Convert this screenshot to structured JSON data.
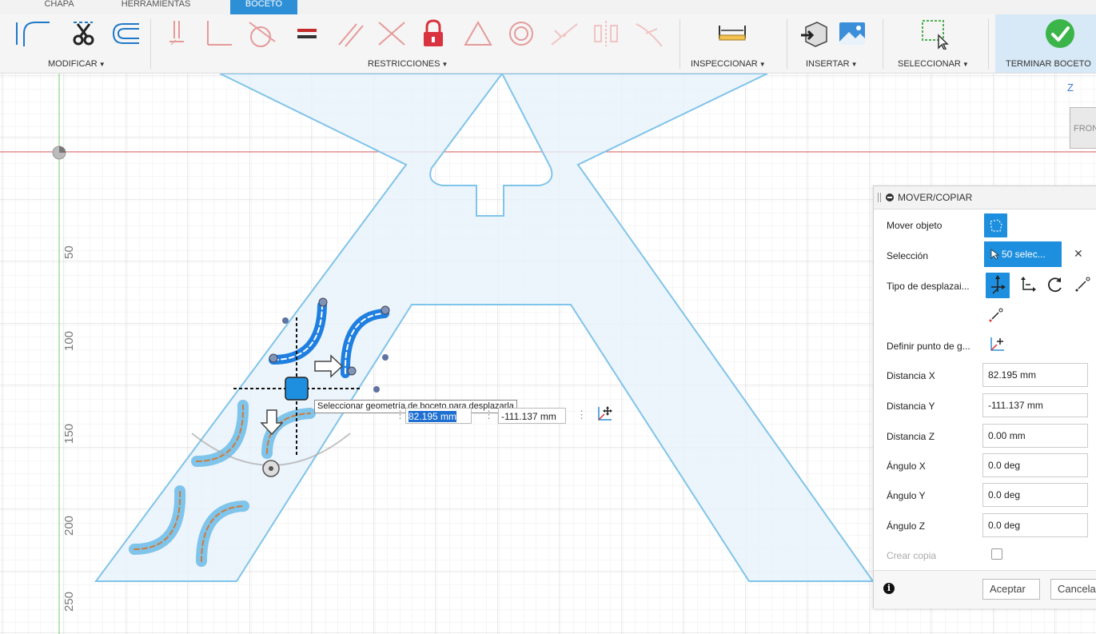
{
  "tabs": [
    {
      "label": "CHAPA"
    },
    {
      "label": "HERRAMIENTAS"
    },
    {
      "label": "BOCETO"
    }
  ],
  "toolbar": {
    "groups": {
      "modificar": "MODIFICAR",
      "restricciones": "RESTRICCIONES",
      "inspeccionar": "INSPECCIONAR",
      "insertar": "INSERTAR",
      "seleccionar": "SELECCIONAR",
      "terminar": "TERMINAR BOCETO"
    },
    "caret": "▼",
    "accent_color": "#2d8fd5",
    "finish_color": "#3bb54a"
  },
  "canvas": {
    "ruler_labels": [
      "50",
      "100",
      "150",
      "200",
      "250"
    ],
    "viewcube_axis": "Z",
    "viewcube_face": "FRONT",
    "tooltip": "Seleccionar geometría de boceto para desplazarla",
    "inline_x": "82.195 mm",
    "inline_y": "-111.137 mm"
  },
  "dialog": {
    "title": "MOVER/COPIAR",
    "rows": {
      "mover_objeto": "Mover objeto",
      "seleccion": "Selección",
      "seleccion_value": "50 selec...",
      "tipo_desplazamiento": "Tipo de desplazai...",
      "definir_punto": "Definir punto de g...",
      "distancia_x": "Distancia X",
      "distancia_y": "Distancia Y",
      "distancia_z": "Distancia Z",
      "angulo_x": "Ángulo X",
      "angulo_y": "Ángulo Y",
      "angulo_z": "Ángulo Z",
      "crear_copia": "Crear copia"
    },
    "values": {
      "distancia_x": "82.195 mm",
      "distancia_y": "-111.137 mm",
      "distancia_z": "0.00 mm",
      "angulo_x": "0.0 deg",
      "angulo_y": "0.0 deg",
      "angulo_z": "0.0 deg"
    },
    "crear_copia_checked": false,
    "buttons": {
      "aceptar": "Aceptar",
      "cancelar": "Cancelar"
    }
  }
}
